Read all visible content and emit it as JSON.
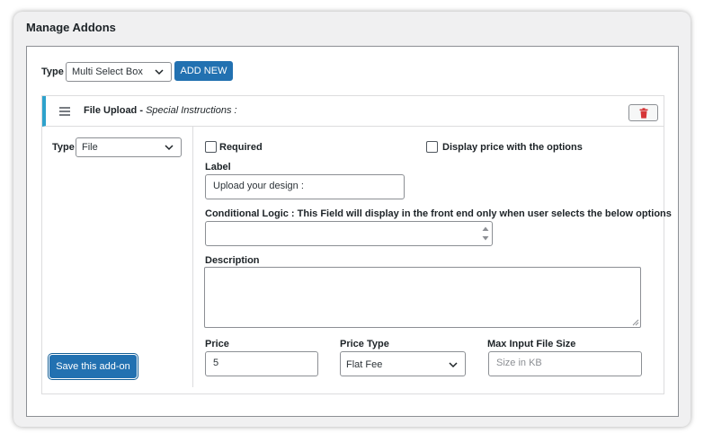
{
  "page": {
    "title": "Manage Addons"
  },
  "toolbar": {
    "type_label": "Type",
    "type_value": "Multi Select Box",
    "add_new_label": "ADD NEW"
  },
  "addon": {
    "title_bold": "File Upload -",
    "title_italic": "Special Instructions :",
    "type_label": "Type",
    "type_value": "File",
    "required_label": "Required",
    "required_checked": false,
    "display_price_label": "Display price with the options",
    "display_price_checked": false,
    "field_label_label": "Label",
    "field_label_value": "Upload your design :",
    "conditional_label": "Conditional Logic : This Field will display in the front end only when user selects the below options",
    "conditional_value": "",
    "description_label": "Description",
    "description_value": "",
    "price_label": "Price",
    "price_value": "5",
    "price_type_label": "Price Type",
    "price_type_value": "Flat Fee",
    "max_size_label": "Max Input File Size",
    "max_size_placeholder": "Size in KB",
    "max_size_value": "",
    "save_label": "Save this add-on"
  },
  "colors": {
    "primary": "#2271b1",
    "accent_bar": "#2ea2cc",
    "delete_icon": "#d63638"
  }
}
